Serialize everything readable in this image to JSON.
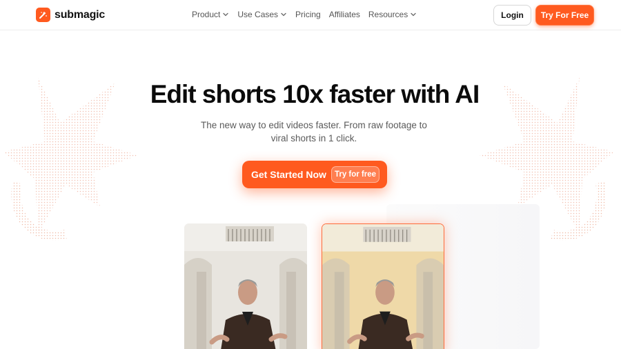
{
  "brand": {
    "name": "submagic",
    "accent": "#ff5a1f"
  },
  "nav": [
    {
      "label": "Product",
      "has_dropdown": true
    },
    {
      "label": "Use Cases",
      "has_dropdown": true
    },
    {
      "label": "Pricing",
      "has_dropdown": false
    },
    {
      "label": "Affiliates",
      "has_dropdown": false
    },
    {
      "label": "Resources",
      "has_dropdown": true
    }
  ],
  "auth": {
    "login_label": "Login",
    "try_label": "Try For Free"
  },
  "hero": {
    "title": "Edit shorts 10x faster with AI",
    "subtitle": "The new way to edit videos faster. From raw footage to viral shorts in 1 click.",
    "cta_label": "Get Started Now",
    "cta_badge": "Try for free"
  },
  "videos": [
    {
      "name": "before-video",
      "tone": "#e8e5df",
      "highlighted": false
    },
    {
      "name": "after-video",
      "tone": "#efd9a8",
      "highlighted": true
    }
  ],
  "icons": {
    "logo": "submagic-logo-icon",
    "dropdown": "chevron-down-icon",
    "decoration": "star-icon"
  }
}
